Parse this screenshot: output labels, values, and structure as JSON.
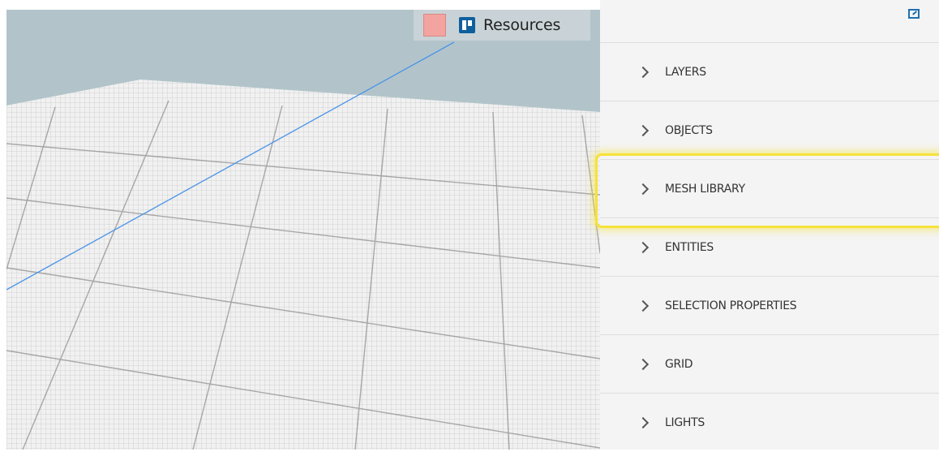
{
  "viewport": {
    "resource_tag": {
      "color": "#f3a3a0",
      "icon": "board-icon",
      "label": "Resources"
    }
  },
  "panel": {
    "popout_icon": "external-window-icon",
    "sections": [
      {
        "label": "LAYERS",
        "icon": "chevron-right-icon"
      },
      {
        "label": "OBJECTS",
        "icon": "chevron-right-icon"
      },
      {
        "label": "MESH LIBRARY",
        "icon": "chevron-right-icon",
        "highlighted": true
      },
      {
        "label": "ENTITIES",
        "icon": "chevron-right-icon"
      },
      {
        "label": "SELECTION PROPERTIES",
        "icon": "chevron-right-icon"
      },
      {
        "label": "GRID",
        "icon": "chevron-right-icon"
      },
      {
        "label": "LIGHTS",
        "icon": "chevron-right-icon"
      }
    ]
  },
  "colors": {
    "sky": "#b2c4ca",
    "highlight": "#f6e23a",
    "panel_bg": "#f4f4f4"
  }
}
